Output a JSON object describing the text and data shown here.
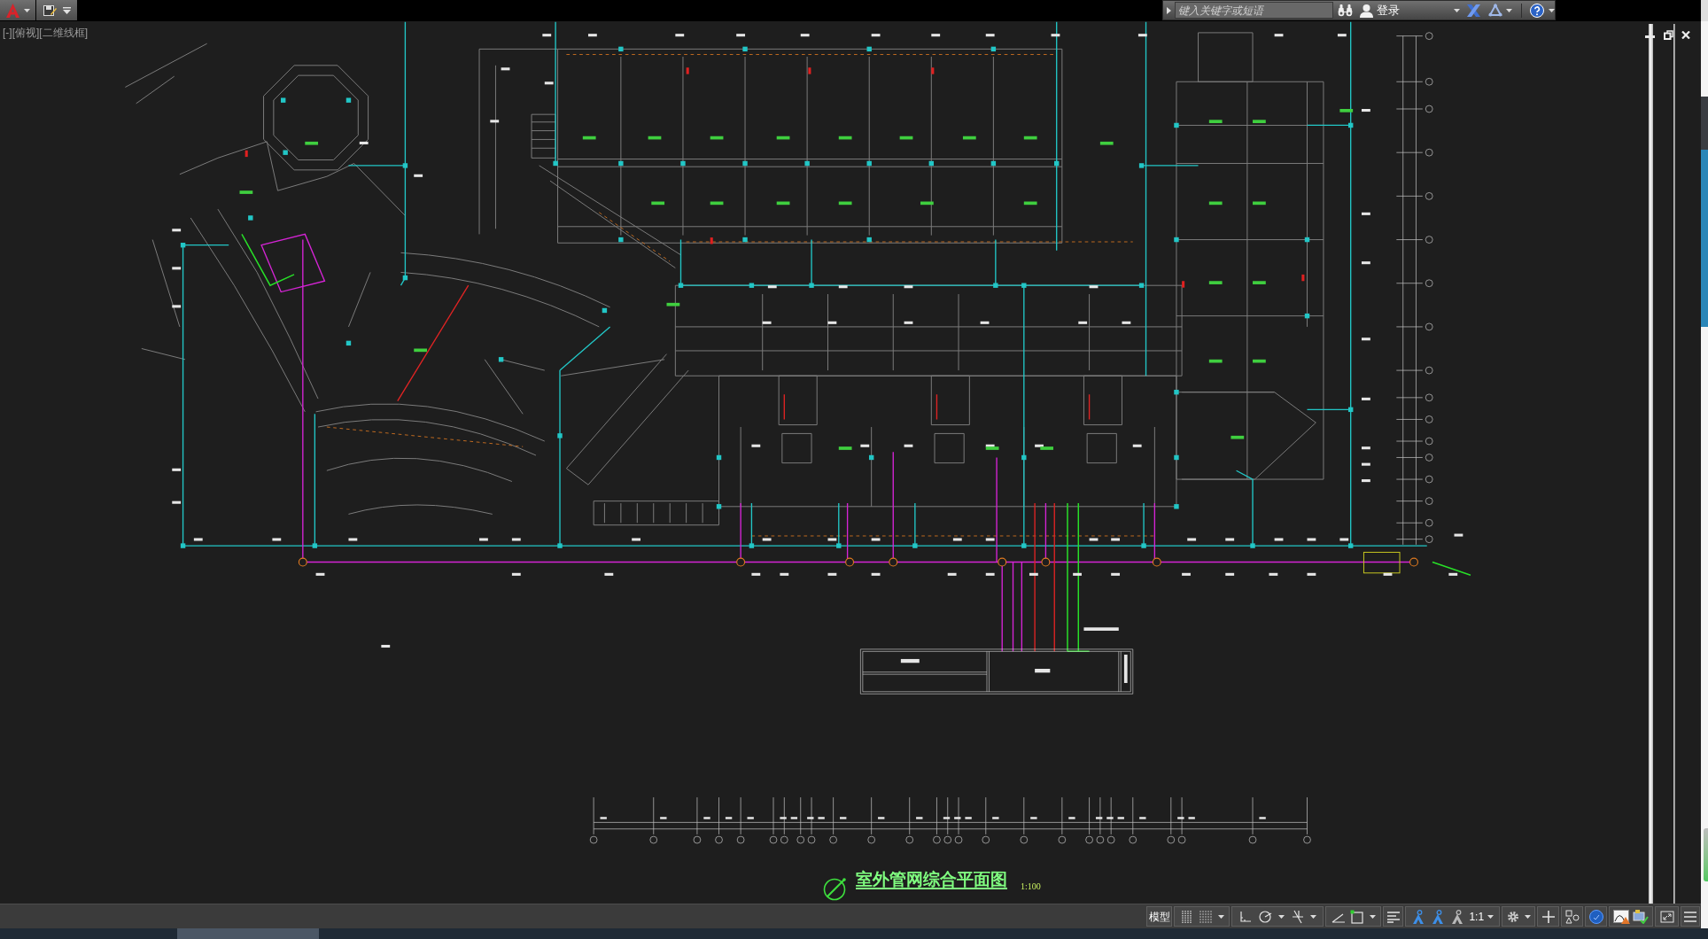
{
  "info_center": {
    "search": {
      "placeholder": "键入关键字或短语"
    },
    "sign_in": "登录"
  },
  "viewport": {
    "label": "[-][俯视][二维线框]"
  },
  "drawing": {
    "title": "室外管网综合平面图",
    "scale": "1:100"
  },
  "status_bar": {
    "model_button": "模型",
    "annotation_tools": [
      {
        "on": true
      },
      {
        "on": true
      },
      {
        "on": false
      }
    ],
    "annotation_scale": "1:1"
  }
}
